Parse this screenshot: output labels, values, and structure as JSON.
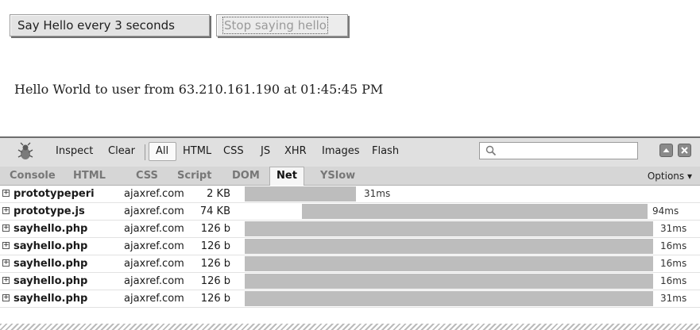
{
  "page": {
    "say_hello_button": "Say Hello every 3 seconds",
    "stop_button": "Stop saying hello",
    "hello_message": "Hello World to user from 63.210.161.190 at 01:45:45 PM"
  },
  "firebug": {
    "toolbar": {
      "inspect": "Inspect",
      "clear": "Clear",
      "filters": [
        "All",
        "HTML",
        "CSS",
        "JS",
        "XHR",
        "Images",
        "Flash"
      ],
      "active_filter": "All"
    },
    "tabs": [
      "Console",
      "HTML",
      "CSS",
      "Script",
      "DOM",
      "Net",
      "YSlow"
    ],
    "active_tab": "Net",
    "options": "Options ▾",
    "net_requests": [
      {
        "name": "prototypeperi",
        "domain": "ajaxref.com",
        "size": "2 KB",
        "time": "31ms"
      },
      {
        "name": "prototype.js",
        "domain": "ajaxref.com",
        "size": "74 KB",
        "time": "94ms"
      },
      {
        "name": "sayhello.php",
        "domain": "ajaxref.com",
        "size": "126 b",
        "time": "31ms"
      },
      {
        "name": "sayhello.php",
        "domain": "ajaxref.com",
        "size": "126 b",
        "time": "16ms"
      },
      {
        "name": "sayhello.php",
        "domain": "ajaxref.com",
        "size": "126 b",
        "time": "16ms"
      },
      {
        "name": "sayhello.php",
        "domain": "ajaxref.com",
        "size": "126 b",
        "time": "16ms"
      },
      {
        "name": "sayhello.php",
        "domain": "ajaxref.com",
        "size": "126 b",
        "time": "31ms"
      }
    ],
    "colors": {
      "bar": "#bdbdbd",
      "toolbar": "#e0e0e0",
      "tabs": "#d6d6d6"
    }
  }
}
